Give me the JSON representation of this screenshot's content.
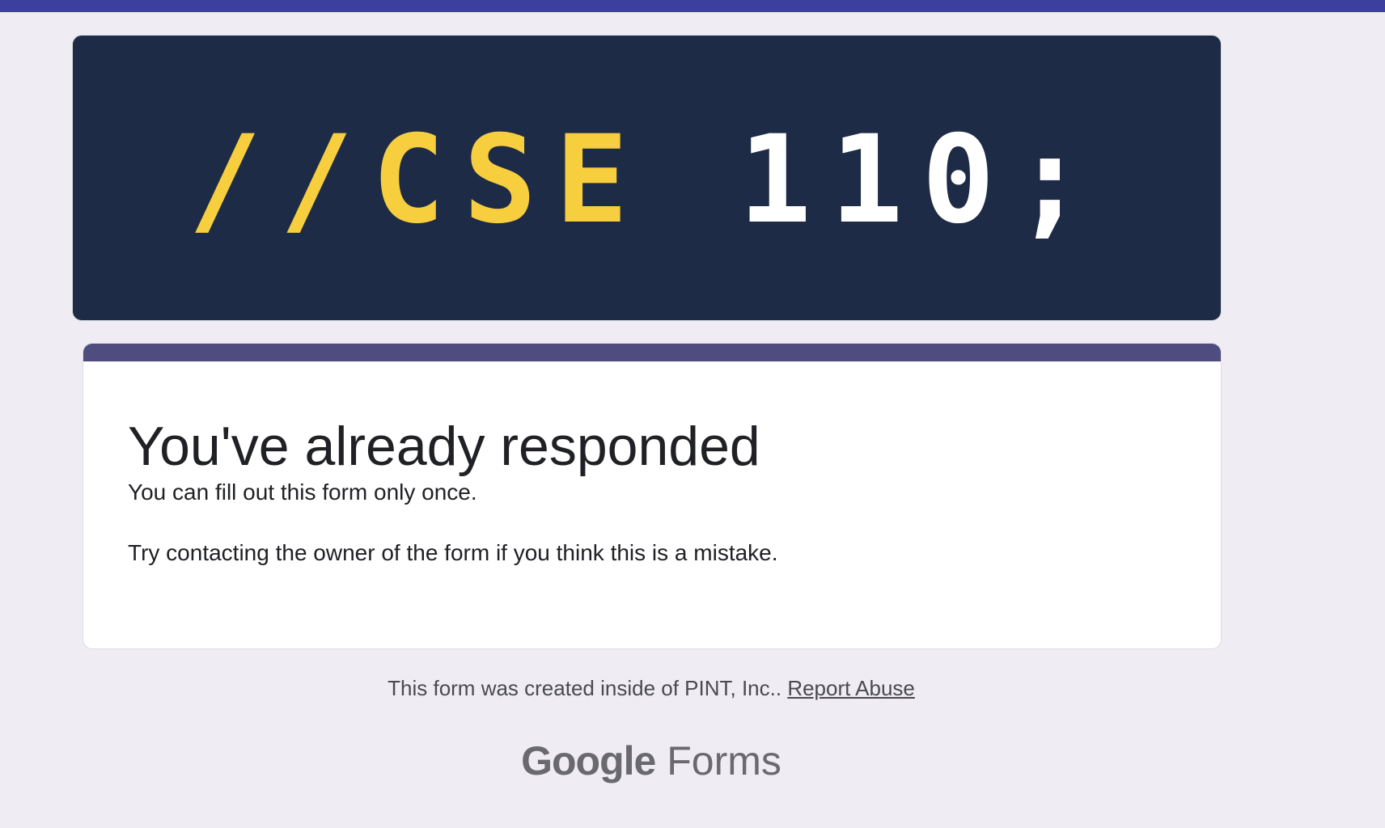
{
  "colors": {
    "top_bar": "#3a3fa0",
    "banner_bg": "#1e2b47",
    "accent_yellow": "#f7ce3e",
    "card_stripe": "#4f4c80"
  },
  "banner": {
    "part1": "//CSE ",
    "part2": "110;"
  },
  "card": {
    "title": "You've already responded",
    "line1": "You can fill out this form only once.",
    "line2": "Try contacting the owner of the form if you think this is a mistake."
  },
  "footer": {
    "text": "This form was created inside of PINT, Inc.. ",
    "report_abuse": "Report Abuse"
  },
  "logo": {
    "google": "Google",
    "forms": "Forms"
  }
}
